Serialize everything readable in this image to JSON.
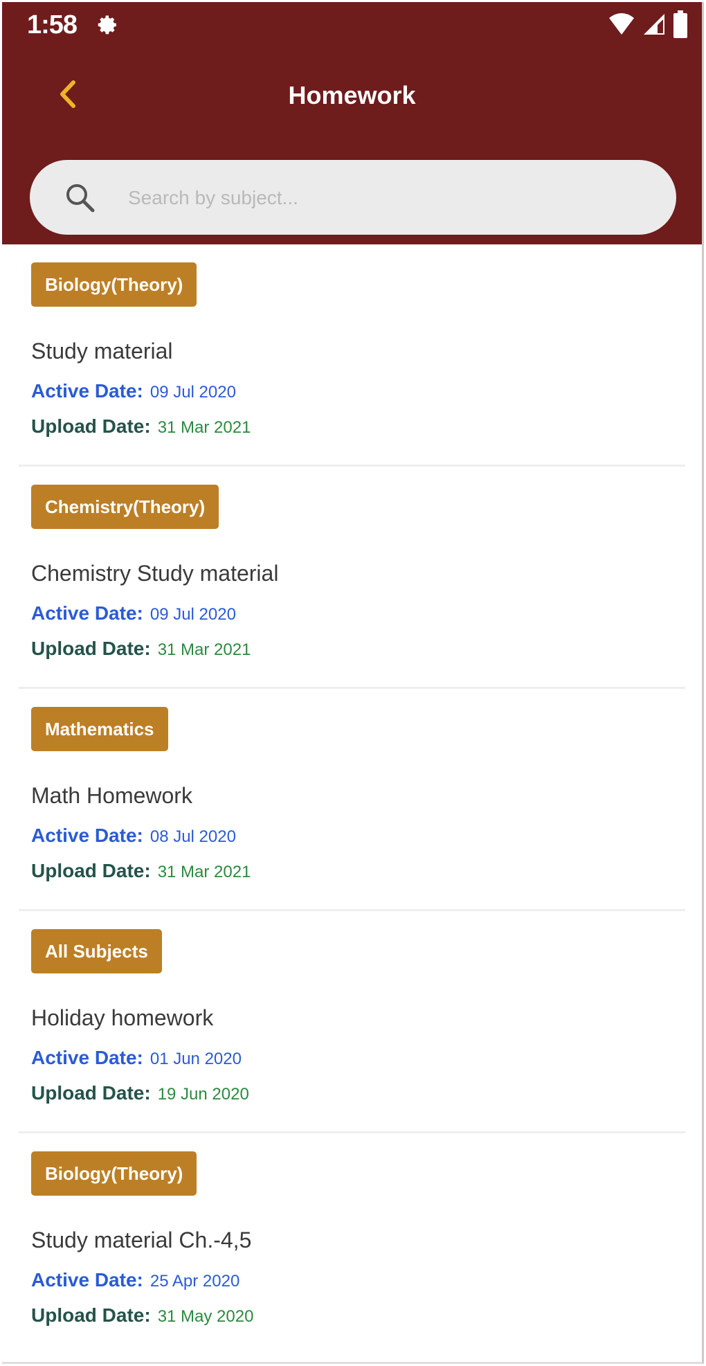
{
  "status_bar": {
    "time": "1:58",
    "icons": [
      "gear-icon",
      "wifi-icon",
      "signal-icon",
      "battery-icon"
    ]
  },
  "header": {
    "back_icon": "chevron-left-icon",
    "title": "Homework"
  },
  "search": {
    "placeholder": "Search by subject...",
    "value": "",
    "icon": "search-icon"
  },
  "labels": {
    "active_date": "Active Date:",
    "upload_date": "Upload Date:"
  },
  "homework": [
    {
      "subject": "Biology(Theory)",
      "title": "Study material",
      "active_date": "09 Jul 2020",
      "upload_date": "31 Mar 2021"
    },
    {
      "subject": "Chemistry(Theory)",
      "title": "Chemistry Study material",
      "active_date": "09 Jul 2020",
      "upload_date": "31 Mar 2021"
    },
    {
      "subject": "Mathematics",
      "title": "Math Homework",
      "active_date": "08 Jul 2020",
      "upload_date": "31 Mar 2021"
    },
    {
      "subject": "All Subjects",
      "title": "Holiday homework",
      "active_date": "01 Jun 2020",
      "upload_date": "19 Jun 2020"
    },
    {
      "subject": "Biology(Theory)",
      "title": "Study material Ch.-4,5",
      "active_date": "25 Apr 2020",
      "upload_date": "31 May 2020"
    }
  ],
  "colors": {
    "app_bar": "#6f1c1d",
    "accent": "#f0b429",
    "subject_tag": "#bd7f25",
    "active_date": "#2a5bd7",
    "upload_label": "#24534a",
    "upload_value": "#2b8a3e"
  }
}
